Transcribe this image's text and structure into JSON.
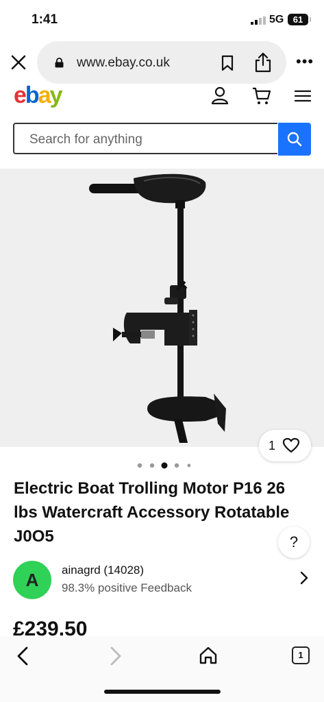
{
  "status": {
    "time": "1:41",
    "network": "5G",
    "battery": "61"
  },
  "browser": {
    "url": "www.ebay.co.uk",
    "tab_count": "1"
  },
  "header": {
    "logo_letters": [
      "e",
      "b",
      "a",
      "y"
    ],
    "logo_colors": [
      "#e53238",
      "#0064d2",
      "#f5af02",
      "#86b817"
    ]
  },
  "search": {
    "placeholder": "Search for anything"
  },
  "gallery": {
    "like_count": "1",
    "image_count": 5,
    "active_image": 3
  },
  "listing": {
    "title": "Electric Boat Trolling Motor P16 26 lbs Watercraft Accessory Rotatable J0O5",
    "price": "£239.50"
  },
  "seller": {
    "initial": "A",
    "name": "ainagrd (14028)",
    "feedback": "98.3% positive Feedback"
  },
  "help": {
    "label": "?"
  },
  "colors": {
    "accent": "#1a73ff",
    "avatar": "#2fd157"
  }
}
